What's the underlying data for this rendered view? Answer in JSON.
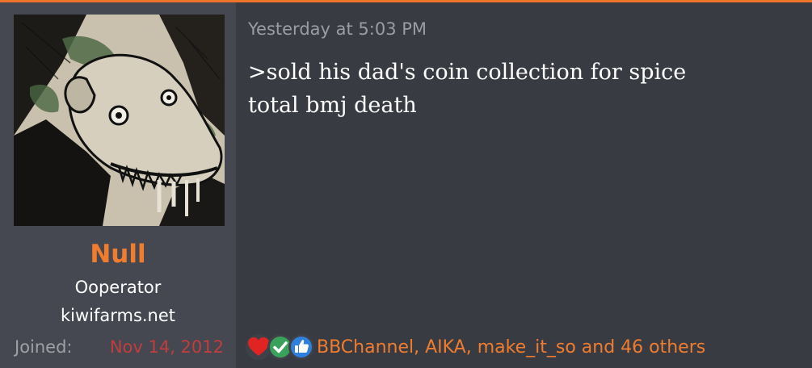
{
  "post": {
    "timestamp": "Yesterday at 5:03 PM",
    "message_lines": [
      ">sold his dad's coin collection for spice",
      "total bmj death"
    ]
  },
  "user": {
    "name": "Null",
    "title_line1": "Ooperator",
    "title_line2": "kiwifarms.net",
    "joined_label": "Joined:",
    "joined_value": "Nov 14, 2012",
    "avatar_icon": "avatar-drawing-icon"
  },
  "reactions": {
    "icons": [
      "heart-love-icon",
      "checkmark-agree-icon",
      "thumbs-up-like-icon"
    ],
    "text": "BBChannel, AIKA, make_it_so and 46 others"
  },
  "colors": {
    "accent": "#f07c2e",
    "background": "#393b42",
    "sidebar": "#454850",
    "joined_date": "#c23d3d"
  }
}
